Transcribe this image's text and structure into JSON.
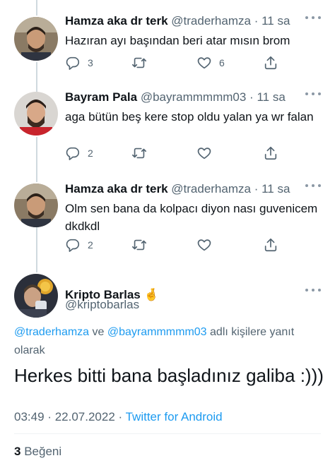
{
  "replies": [
    {
      "name": "Hamza aka dr terk",
      "handle": "@traderhamza",
      "separator": "·",
      "time": "11 sa",
      "text": "Hazıran ayı başından beri atar mısın brom",
      "counts": {
        "reply": "3",
        "retweet": "",
        "like": "6"
      }
    },
    {
      "name": "Bayram Pala",
      "handle": "@bayrammmmm03",
      "separator": "·",
      "time": "11 sa",
      "text": "aga bütün beş kere stop oldu yalan ya wr falan",
      "counts": {
        "reply": "2",
        "retweet": "",
        "like": ""
      }
    },
    {
      "name": "Hamza aka dr terk",
      "handle": "@traderhamza",
      "separator": "·",
      "time": "11 sa",
      "text": "Olm sen bana da kolpacı diyon nası guvenicem dkdkdl",
      "counts": {
        "reply": "2",
        "retweet": "",
        "like": ""
      }
    }
  ],
  "main_tweet": {
    "name": "Kripto Barlas",
    "emoji": "🤞",
    "handle": "@kriptobarlas",
    "reply_to": {
      "mention1": "@traderhamza",
      "conj": "ve",
      "mention2": "@bayrammmmm03",
      "suffix": "adlı kişilere yanıt olarak"
    },
    "text": "Herkes bitti bana başladınız galiba :)))",
    "time": "03:49",
    "date": "22.07.2022",
    "separator": "·",
    "source": "Twitter for Android",
    "likes_count": "3",
    "likes_label": "Beğeni"
  },
  "icons": [
    "reply-icon",
    "retweet-icon",
    "like-icon",
    "share-icon",
    "more-icon"
  ],
  "colors": {
    "link": "#1d9bf0",
    "secondary": "#536471",
    "thread_line": "#cfd9de",
    "text": "#0f1419"
  }
}
